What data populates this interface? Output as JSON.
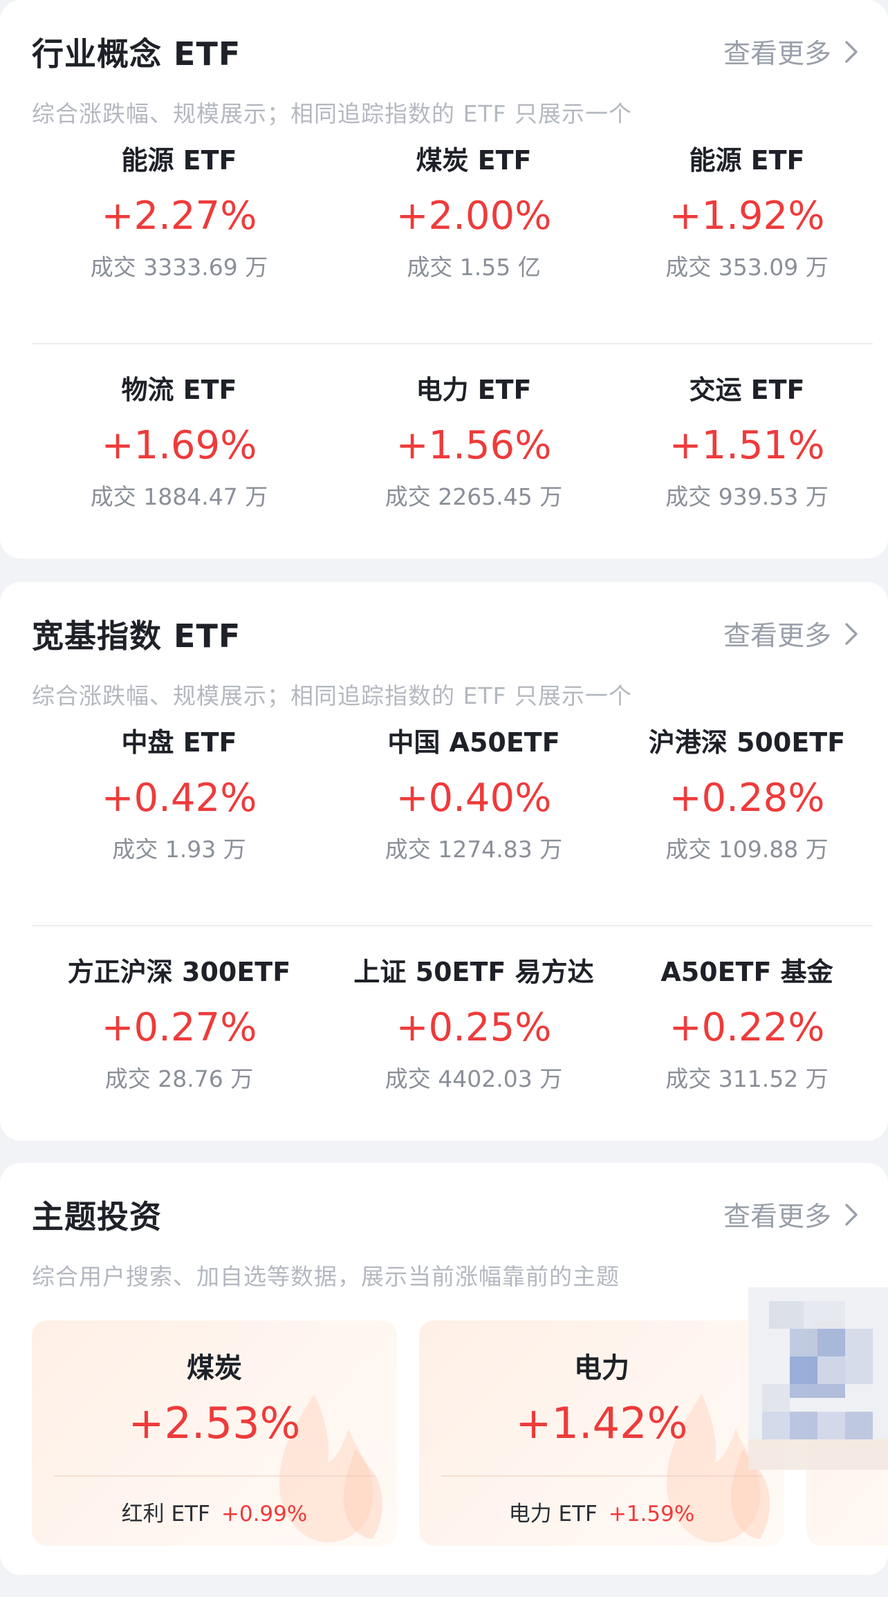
{
  "colors": {
    "rise": "#ee3b3b",
    "more_link": "#9aa0aa",
    "subtitle": "#b4b8c0",
    "page_bg": "#f2f3f6",
    "card_bg": "#ffffff",
    "theme_card_bg": "#fff0e6"
  },
  "icons": {
    "more": "chevron-right-icon",
    "theme_decoration": "flame-icon"
  },
  "industry": {
    "title": "行业概念 ETF",
    "more_label": "查看更多",
    "subtitle": "综合涨跌幅、规模展示；相同追踪指数的 ETF 只展示一个",
    "items": [
      {
        "name": "能源 ETF",
        "change": "+2.27%",
        "volume": "成交 3333.69 万"
      },
      {
        "name": "煤炭 ETF",
        "change": "+2.00%",
        "volume": "成交 1.55 亿"
      },
      {
        "name": "能源 ETF",
        "change": "+1.92%",
        "volume": "成交 353.09 万"
      },
      {
        "name": "物流 ETF",
        "change": "+1.69%",
        "volume": "成交 1884.47 万"
      },
      {
        "name": "电力 ETF",
        "change": "+1.56%",
        "volume": "成交 2265.45 万"
      },
      {
        "name": "交运 ETF",
        "change": "+1.51%",
        "volume": "成交 939.53 万"
      }
    ]
  },
  "broad": {
    "title": "宽基指数 ETF",
    "more_label": "查看更多",
    "subtitle": "综合涨跌幅、规模展示；相同追踪指数的 ETF 只展示一个",
    "items": [
      {
        "name": "中盘 ETF",
        "change": "+0.42%",
        "volume": "成交 1.93 万"
      },
      {
        "name": "中国 A50ETF",
        "change": "+0.40%",
        "volume": "成交 1274.83 万"
      },
      {
        "name": "沪港深 500ETF",
        "change": "+0.28%",
        "volume": "成交 109.88 万"
      },
      {
        "name": "方正沪深 300ETF",
        "change": "+0.27%",
        "volume": "成交 28.76 万"
      },
      {
        "name": "上证 50ETF 易方达",
        "change": "+0.25%",
        "volume": "成交 4402.03 万"
      },
      {
        "name": "A50ETF 基金",
        "change": "+0.22%",
        "volume": "成交 311.52 万"
      }
    ]
  },
  "theme": {
    "title": "主题投资",
    "more_label": "查看更多",
    "subtitle": "综合用户搜索、加自选等数据，展示当前涨幅靠前的主题",
    "cards": [
      {
        "name": "煤炭",
        "change": "+2.53%",
        "etf_name": "红利 ETF",
        "etf_change": "+0.99%"
      },
      {
        "name": "电力",
        "change": "+1.42%",
        "etf_name": "电力 ETF",
        "etf_change": "+1.59%"
      }
    ]
  }
}
